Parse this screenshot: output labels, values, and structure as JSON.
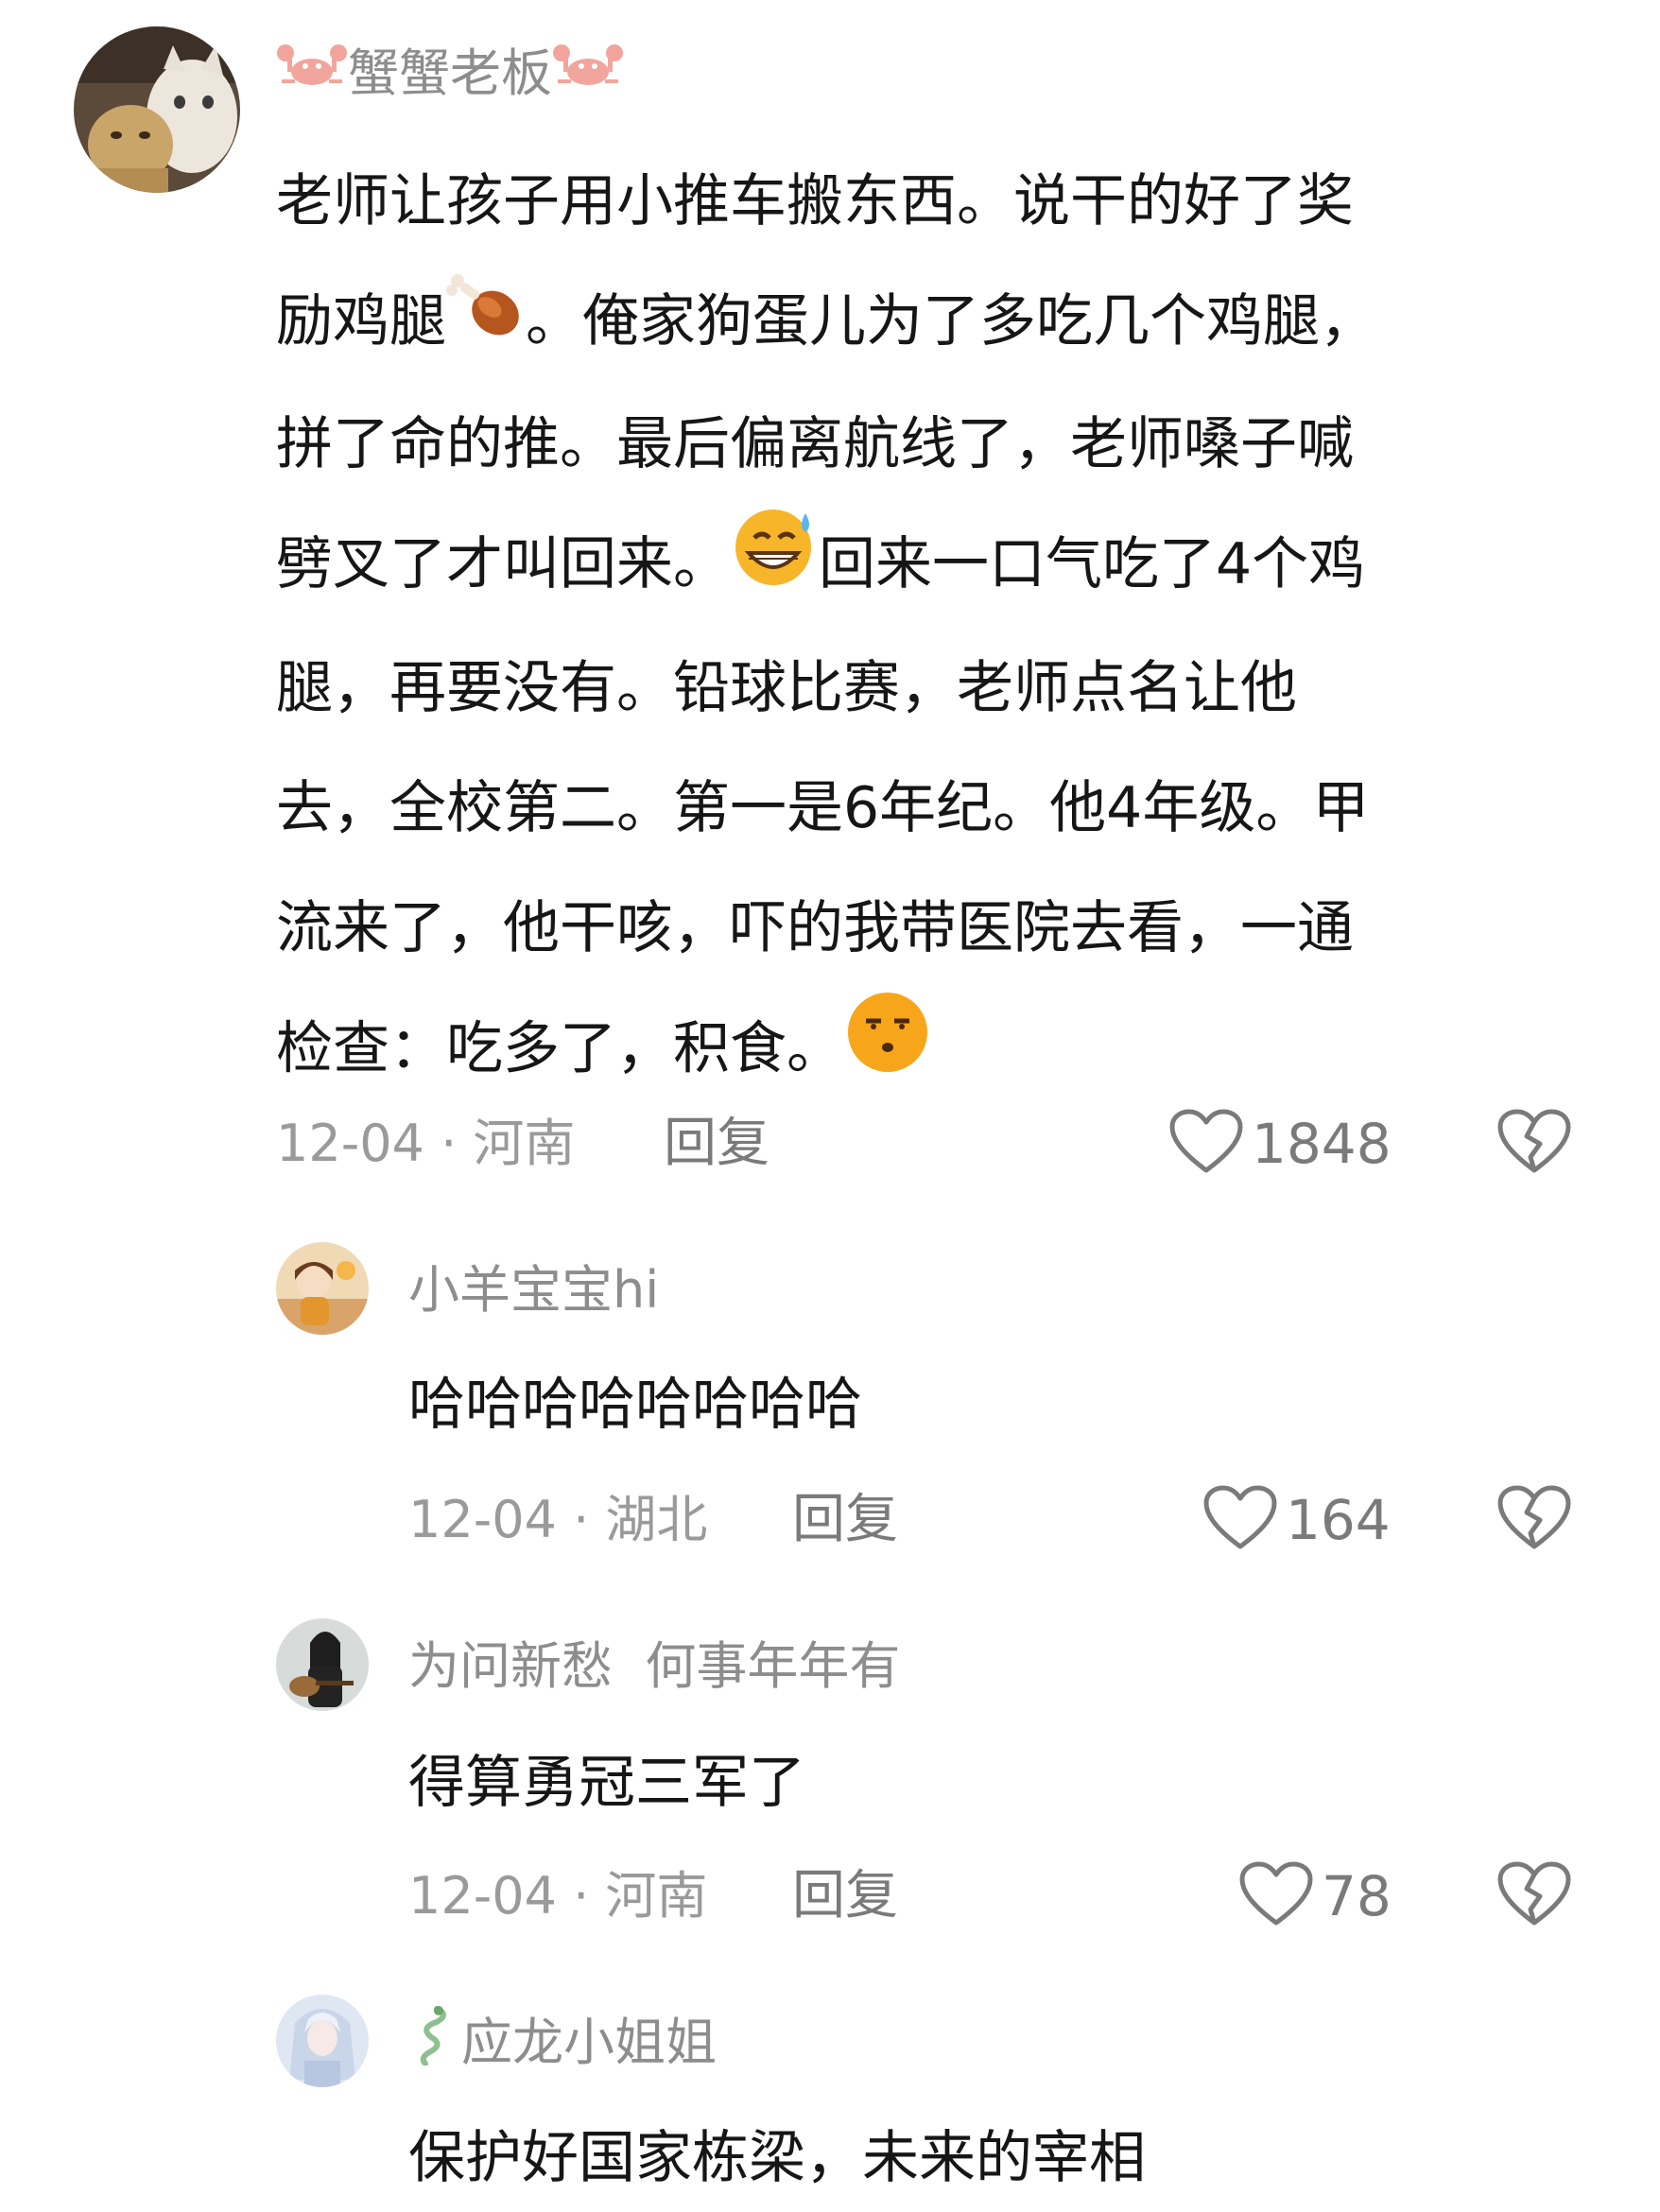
{
  "comments": [
    {
      "username": "蟹蟹老板",
      "username_icon": "crab-icon",
      "avatar": "cats-avatar",
      "text_lines": [
        {
          "pre": "老师让孩子用小推车搬东西。说干的好了奖"
        },
        {
          "pre": "励鸡腿",
          "emoji": "drumstick-icon",
          "post": "。俺家狗蛋儿为了多吃几个鸡腿，"
        },
        {
          "pre": "拼了命的推。最后偏离航线了，老师嗓子喊"
        },
        {
          "pre": "劈叉了才叫回来。",
          "emoji": "grin-sweat-emoji",
          "post": "回来一口气吃了4个鸡"
        },
        {
          "pre": "腿，再要没有。铅球比赛，老师点名让他"
        },
        {
          "pre": "去，全校第二。第一是6年纪。他4年级。甲"
        },
        {
          "pre": "流来了，他干咳，吓的我带医院去看，一通"
        },
        {
          "pre": "检查：吃多了，积食。",
          "emoji": "unamused-emoji",
          "post": ""
        }
      ],
      "meta": "12-04 · 河南",
      "reply_label": "回复",
      "likes": "1848"
    },
    {
      "username": "小羊宝宝hi",
      "avatar": "girl-avatar",
      "text": "哈哈哈哈哈哈哈哈",
      "meta": "12-04 · 湖北",
      "reply_label": "回复",
      "likes": "164"
    },
    {
      "username": "为问新愁  何事年年有",
      "avatar": "guitar-avatar",
      "text": "得算勇冠三军了",
      "meta": "12-04 · 河南",
      "reply_label": "回复",
      "likes": "78"
    },
    {
      "username": "应龙小姐姐",
      "username_icon": "dragon-icon",
      "avatar": "fairy-avatar",
      "text": "保护好国家栋梁，未来的宰相"
    }
  ],
  "colors": {
    "username": "#8d8d8d",
    "text": "#161616",
    "meta": "#9a9a9a",
    "icon": "#7a7a7a"
  }
}
